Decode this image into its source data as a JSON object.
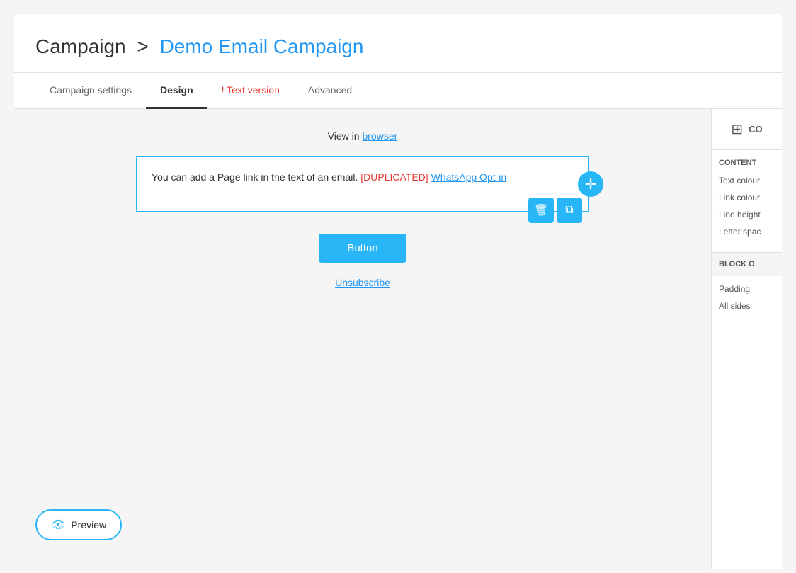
{
  "page": {
    "breadcrumb": {
      "prefix": "Campaign",
      "separator": ">",
      "campaign_name": "Demo Email Campaign"
    }
  },
  "tabs": {
    "items": [
      {
        "id": "campaign-settings",
        "label": "Campaign settings",
        "active": false
      },
      {
        "id": "design",
        "label": "Design",
        "active": true
      },
      {
        "id": "text-version",
        "label": "! Text version",
        "active": false,
        "warning": true
      },
      {
        "id": "advanced",
        "label": "Advanced",
        "active": false
      }
    ]
  },
  "design_area": {
    "view_in_browser_text": "View in ",
    "browser_link": "browser",
    "text_block": {
      "content_prefix": "You can add a Page link in the text of an email. ",
      "duplicated_label": "[DUPLICATED]",
      "whatsapp_link": "WhatsApp Opt-in"
    },
    "cta_button_label": "Button",
    "unsubscribe_label": "Unsubscribe"
  },
  "preview": {
    "label": "Preview"
  },
  "sidebar": {
    "top_label": "CO",
    "content_section_title": "CONTENT",
    "properties": [
      {
        "label": "Text colour"
      },
      {
        "label": "Link colour"
      },
      {
        "label": "Line height"
      },
      {
        "label": "Letter spac"
      }
    ],
    "block_section_title": "BLOCK O",
    "block_properties": [
      {
        "label": "Padding"
      },
      {
        "label": "All sides"
      }
    ]
  },
  "icons": {
    "grid": "⊞",
    "eye": "👁",
    "delete": "🗑",
    "copy": "⧉",
    "move": "✛"
  }
}
